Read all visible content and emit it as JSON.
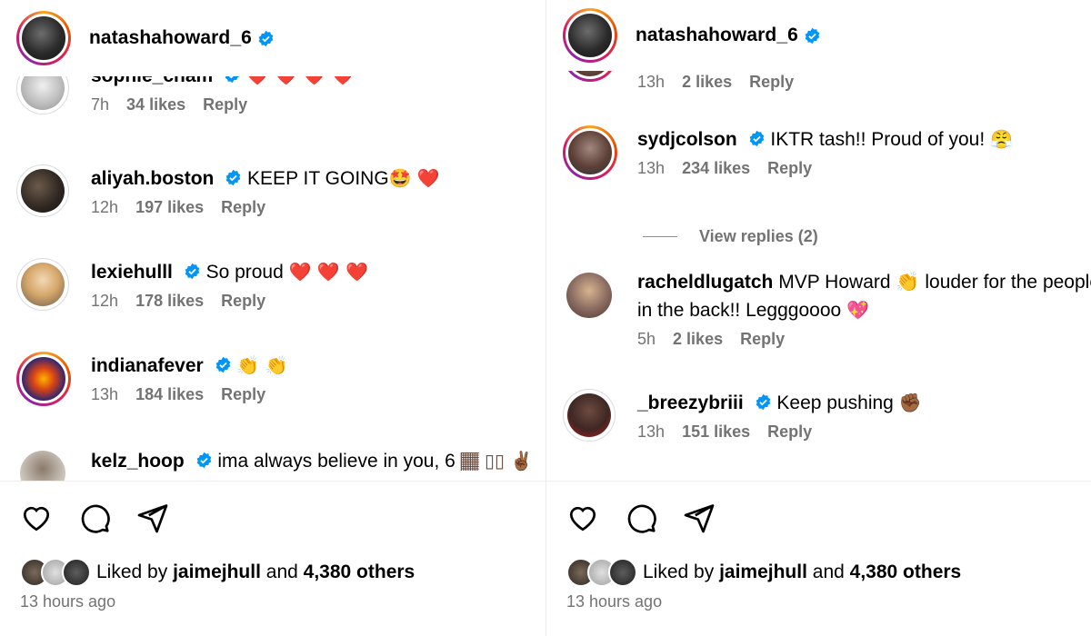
{
  "left": {
    "owner": "natashahoward_6",
    "comments": [
      {
        "user": "sophie_cham",
        "text": "",
        "emoji": "❤️ ❤️ ❤️ ❤️",
        "time": "7h",
        "likes": "34 likes",
        "reply": "Reply"
      },
      {
        "user": "aliyah.boston",
        "text": "KEEP IT GOING",
        "emoji": "🤩 ❤️",
        "time": "12h",
        "likes": "197 likes",
        "reply": "Reply"
      },
      {
        "user": "lexiehulll",
        "text": "So proud",
        "emoji": "❤️ ❤️ ❤️",
        "time": "12h",
        "likes": "178 likes",
        "reply": "Reply"
      },
      {
        "user": "indianafever",
        "text": "",
        "emoji": "👏 👏",
        "time": "13h",
        "likes": "184 likes",
        "reply": "Reply"
      },
      {
        "user": "kelz_hoop",
        "text": "ima always believe in you, 6",
        "emoji": "🏾 ▯▯ ✌🏾",
        "time": "",
        "likes": "",
        "reply": ""
      }
    ],
    "liked_by_prefix": "Liked by",
    "liked_by_user": "jaimejhull",
    "liked_by_and": "and",
    "liked_by_others": "4,380 others",
    "time_ago": "13 hours ago"
  },
  "right": {
    "owner": "natashahoward_6",
    "partial_meta": {
      "time": "13h",
      "likes": "2 likes",
      "reply": "Reply"
    },
    "comments": [
      {
        "user": "sydjcolson",
        "text": "IKTR tash!! Proud of you!",
        "emoji": "😤",
        "time": "13h",
        "likes": "234 likes",
        "reply": "Reply"
      },
      {
        "user": "racheldlugatch",
        "text": "MVP Howard 👏 louder for the people in the back!! Legggoooo",
        "emoji": "💖",
        "time": "5h",
        "likes": "2 likes",
        "reply": "Reply"
      },
      {
        "user": "_breezybriii",
        "text": "Keep pushing",
        "emoji": "✊🏾",
        "time": "13h",
        "likes": "151 likes",
        "reply": "Reply"
      }
    ],
    "view_replies": "View replies (2)",
    "liked_by_prefix": "Liked by",
    "liked_by_user": "jaimejhull",
    "liked_by_and": "and",
    "liked_by_others": "4,380 others",
    "time_ago": "13 hours ago"
  },
  "icons": [
    "heart-icon",
    "comment-icon",
    "share-icon",
    "verified-icon"
  ],
  "colors": {
    "verified": "#0095f6",
    "muted_text": "#737373",
    "heart": "#ed1c24"
  }
}
